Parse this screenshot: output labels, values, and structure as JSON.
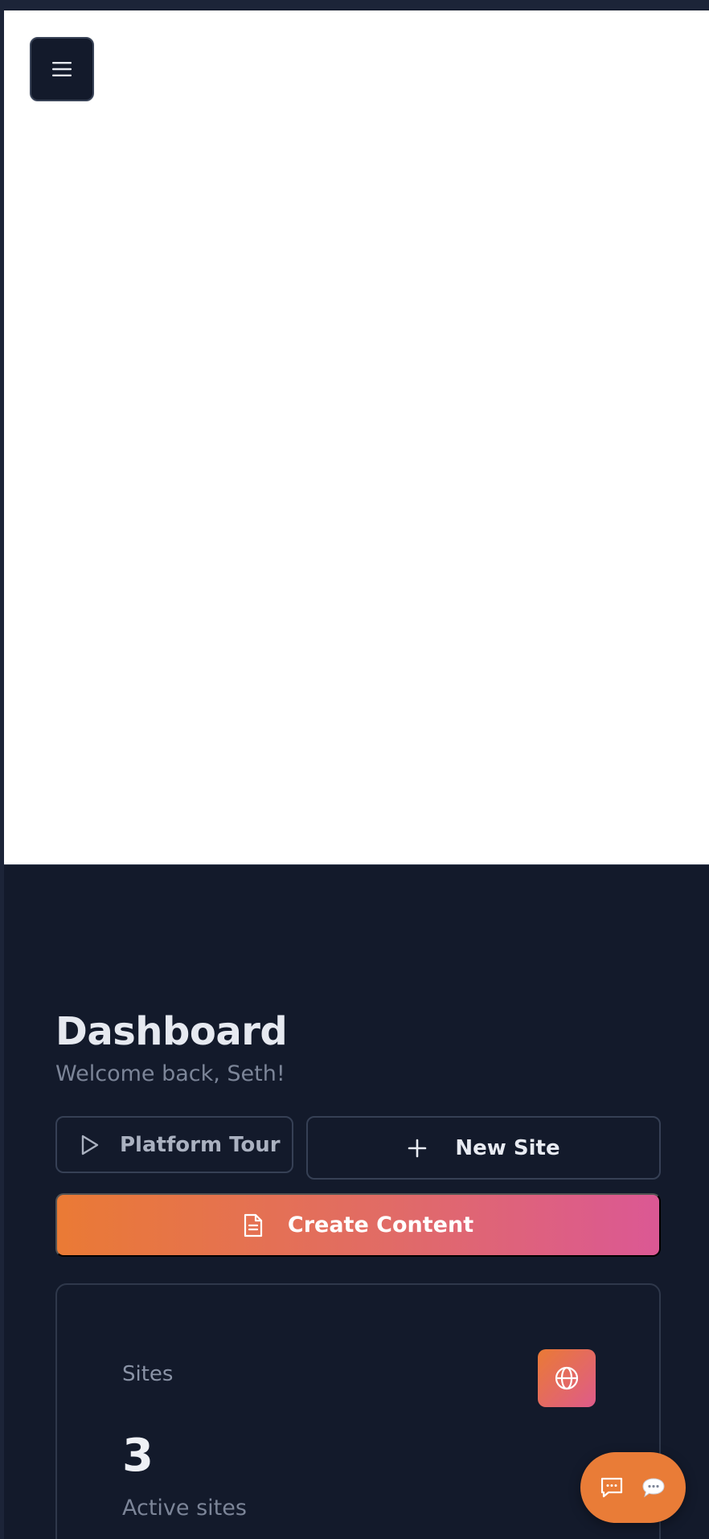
{
  "header": {
    "menu_icon": "hamburger-icon"
  },
  "dashboard": {
    "title": "Dashboard",
    "welcome": "Welcome back, Seth!"
  },
  "actions": {
    "tour_label": "Platform Tour",
    "tour_icon": "play-icon",
    "new_site_label": "New Site",
    "new_site_icon": "plus-icon",
    "create_content_label": "Create Content",
    "create_content_icon": "document-icon"
  },
  "stats": {
    "sites": {
      "label": "Sites",
      "value": "3",
      "caption": "Active sites",
      "icon": "globe-icon"
    }
  },
  "chat": {
    "icons": [
      "message-square-icon",
      "speech-bubble-icon"
    ]
  },
  "colors": {
    "background": "#131a2b",
    "accent_orange": "#ea7a35",
    "accent_pink": "#db5894",
    "text_primary": "#e6e9f0",
    "text_muted": "#7c8598"
  }
}
